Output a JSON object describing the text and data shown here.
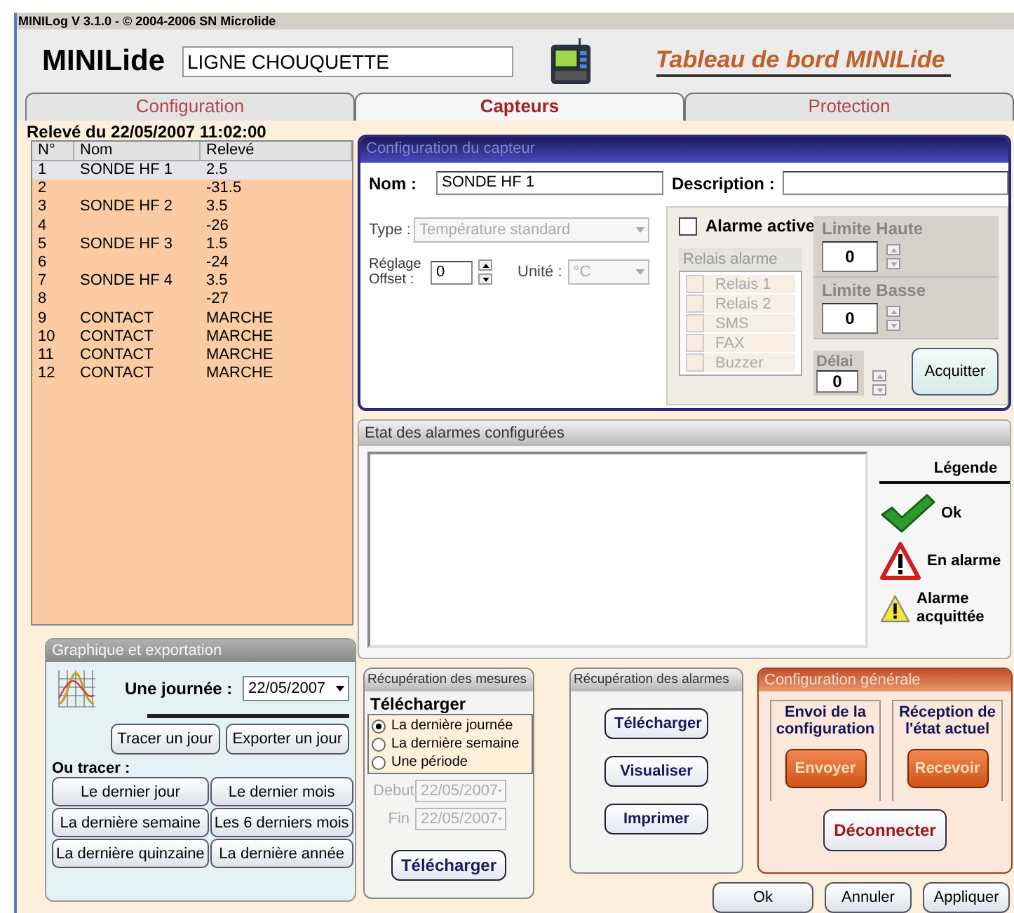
{
  "window": {
    "title": "MINILog V 3.1.0 - © 2004-2006 SN Microlide"
  },
  "header": {
    "brand": "MINILide",
    "site_name": "LIGNE CHOUQUETTE",
    "dashboard_title": "Tableau de bord MINILide"
  },
  "tabs": [
    {
      "label": "Configuration",
      "selected": false
    },
    {
      "label": "Capteurs",
      "selected": true
    },
    {
      "label": "Protection",
      "selected": false
    }
  ],
  "readings": {
    "title": "Relevé du 22/05/2007 11:02:00",
    "columns": [
      "N°",
      "Nom",
      "Relevé"
    ],
    "rows": [
      {
        "no": "1",
        "name": "SONDE HF 1",
        "value": "2.5",
        "selected": true
      },
      {
        "no": "2",
        "value": "-31.5",
        "selected": false
      },
      {
        "no": "3",
        "name": "SONDE HF 2",
        "value": "3.5",
        "selected": false
      },
      {
        "no": "4",
        "value": "-26",
        "selected": false
      },
      {
        "no": "5",
        "name": "SONDE HF 3",
        "value": "1.5",
        "selected": false
      },
      {
        "no": "6",
        "value": "-24",
        "selected": false
      },
      {
        "no": "7",
        "name": "SONDE HF 4",
        "value": "3.5",
        "selected": false
      },
      {
        "no": "8",
        "value": "-27",
        "selected": false
      },
      {
        "no": "9",
        "name": "CONTACT",
        "value": "MARCHE",
        "selected": false
      },
      {
        "no": "10",
        "name": "CONTACT",
        "value": "MARCHE",
        "selected": false
      },
      {
        "no": "11",
        "name": "CONTACT",
        "value": "MARCHE",
        "selected": false
      },
      {
        "no": "12",
        "name": "CONTACT",
        "value": "MARCHE",
        "selected": false
      }
    ]
  },
  "graph_export": {
    "title": "Graphique et exportation",
    "day_label": "Une journée :",
    "date": "22/05/2007",
    "day_buttons": [
      "Tracer un jour",
      "Exporter un jour"
    ],
    "or_label": "Ou tracer :",
    "period_buttons": [
      "Le dernier jour",
      "Le dernier mois",
      "La dernière semaine",
      "Les 6 derniers mois",
      "La dernière quinzaine",
      "La dernière année"
    ]
  },
  "sensor_config": {
    "title": "Configuration du capteur",
    "name_label": "Nom :",
    "name_value": "SONDE HF 1",
    "description_label": "Description :",
    "type": {
      "label": "Type :",
      "value": "Température standard",
      "disabled": true
    },
    "offset": {
      "label": "Réglage Offset :",
      "value": "0"
    },
    "unit": {
      "label": "Unité :",
      "value": "°C",
      "disabled": true
    },
    "alarm_active": {
      "label": "Alarme active",
      "checked": false
    },
    "relays": {
      "title": "Relais alarme",
      "disabled": true,
      "items": [
        {
          "label": "Relais 1",
          "checked": false
        },
        {
          "label": "Relais 2",
          "checked": false
        },
        {
          "label": "SMS",
          "checked": false
        },
        {
          "label": "FAX",
          "checked": false
        },
        {
          "label": "Buzzer",
          "checked": false
        }
      ]
    },
    "high_limit": {
      "label": "Limite Haute",
      "value": "0",
      "disabled": true
    },
    "low_limit": {
      "label": "Limite Basse",
      "value": "0",
      "disabled": true
    },
    "delay": {
      "label": "Délai",
      "value": "0",
      "disabled": true
    },
    "ack_button": "Acquitter"
  },
  "alarm_state": {
    "title": "Etat des alarmes configurées",
    "legend_title": "Légende",
    "legend": [
      {
        "kind": "ok",
        "label": "Ok"
      },
      {
        "kind": "alarm",
        "label": "En alarme"
      },
      {
        "kind": "acknowledged",
        "label": "Alarme acquittée"
      }
    ]
  },
  "measures": {
    "title": "Récupération des mesures",
    "subtitle": "Télécharger",
    "options": [
      {
        "label": "La dernière journée",
        "selected": true
      },
      {
        "label": "La dernière semaine",
        "selected": false
      },
      {
        "label": "Une période",
        "selected": false
      }
    ],
    "from": {
      "label": "Debut",
      "value": "22/05/2007",
      "disabled": true
    },
    "to": {
      "label": "Fin",
      "value": "22/05/2007",
      "disabled": true
    },
    "button": "Télécharger"
  },
  "alarms_download": {
    "title": "Récupération des alarmes",
    "buttons": [
      "Télécharger",
      "Visualiser",
      "Imprimer"
    ]
  },
  "general_config": {
    "title": "Configuration générale",
    "send": {
      "label": "Envoi de la configuration",
      "button": "Envoyer"
    },
    "receive": {
      "label": "Réception de l'état actuel",
      "button": "Recevoir"
    },
    "disconnect": "Déconnecter"
  },
  "footer_buttons": [
    "Ok",
    "Annuler",
    "Appliquer"
  ]
}
